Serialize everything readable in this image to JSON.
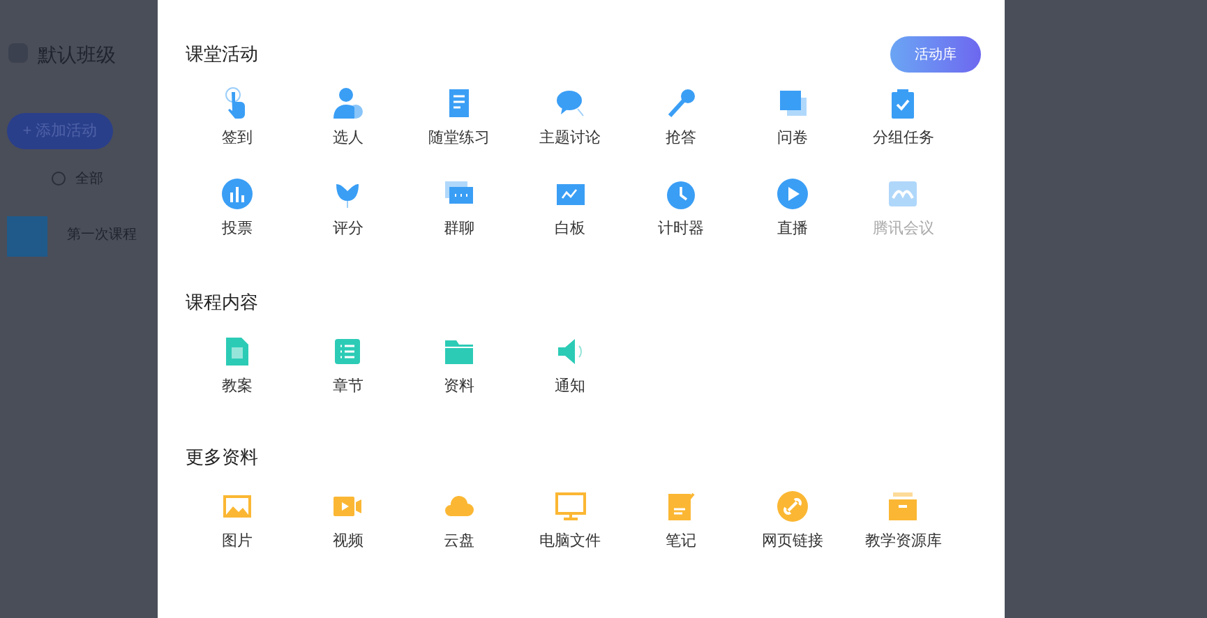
{
  "background": {
    "class_title": "默认班级",
    "add_button": "+ 添加活动",
    "filter": "全部",
    "course": "第一次课程"
  },
  "dialog": {
    "sections": [
      {
        "title": "课堂活动",
        "button": "活动库",
        "items": [
          {
            "label": "签到",
            "disabled": false
          },
          {
            "label": "选人",
            "disabled": false
          },
          {
            "label": "随堂练习",
            "disabled": false
          },
          {
            "label": "主题讨论",
            "disabled": false
          },
          {
            "label": "抢答",
            "disabled": false
          },
          {
            "label": "问卷",
            "disabled": false
          },
          {
            "label": "分组任务",
            "disabled": false
          },
          {
            "label": "投票",
            "disabled": false
          },
          {
            "label": "评分",
            "disabled": false
          },
          {
            "label": "群聊",
            "disabled": false
          },
          {
            "label": "白板",
            "disabled": false
          },
          {
            "label": "计时器",
            "disabled": false
          },
          {
            "label": "直播",
            "disabled": false
          },
          {
            "label": "腾讯会议",
            "disabled": true
          }
        ]
      },
      {
        "title": "课程内容",
        "items": [
          {
            "label": "教案",
            "disabled": false
          },
          {
            "label": "章节",
            "disabled": false
          },
          {
            "label": "资料",
            "disabled": false
          },
          {
            "label": "通知",
            "disabled": false
          }
        ]
      },
      {
        "title": "更多资料",
        "items": [
          {
            "label": "图片",
            "disabled": false
          },
          {
            "label": "视频",
            "disabled": false
          },
          {
            "label": "云盘",
            "disabled": false
          },
          {
            "label": "电脑文件",
            "disabled": false
          },
          {
            "label": "笔记",
            "disabled": false
          },
          {
            "label": "网页链接",
            "disabled": false
          },
          {
            "label": "教学资源库",
            "disabled": false
          }
        ]
      }
    ]
  }
}
